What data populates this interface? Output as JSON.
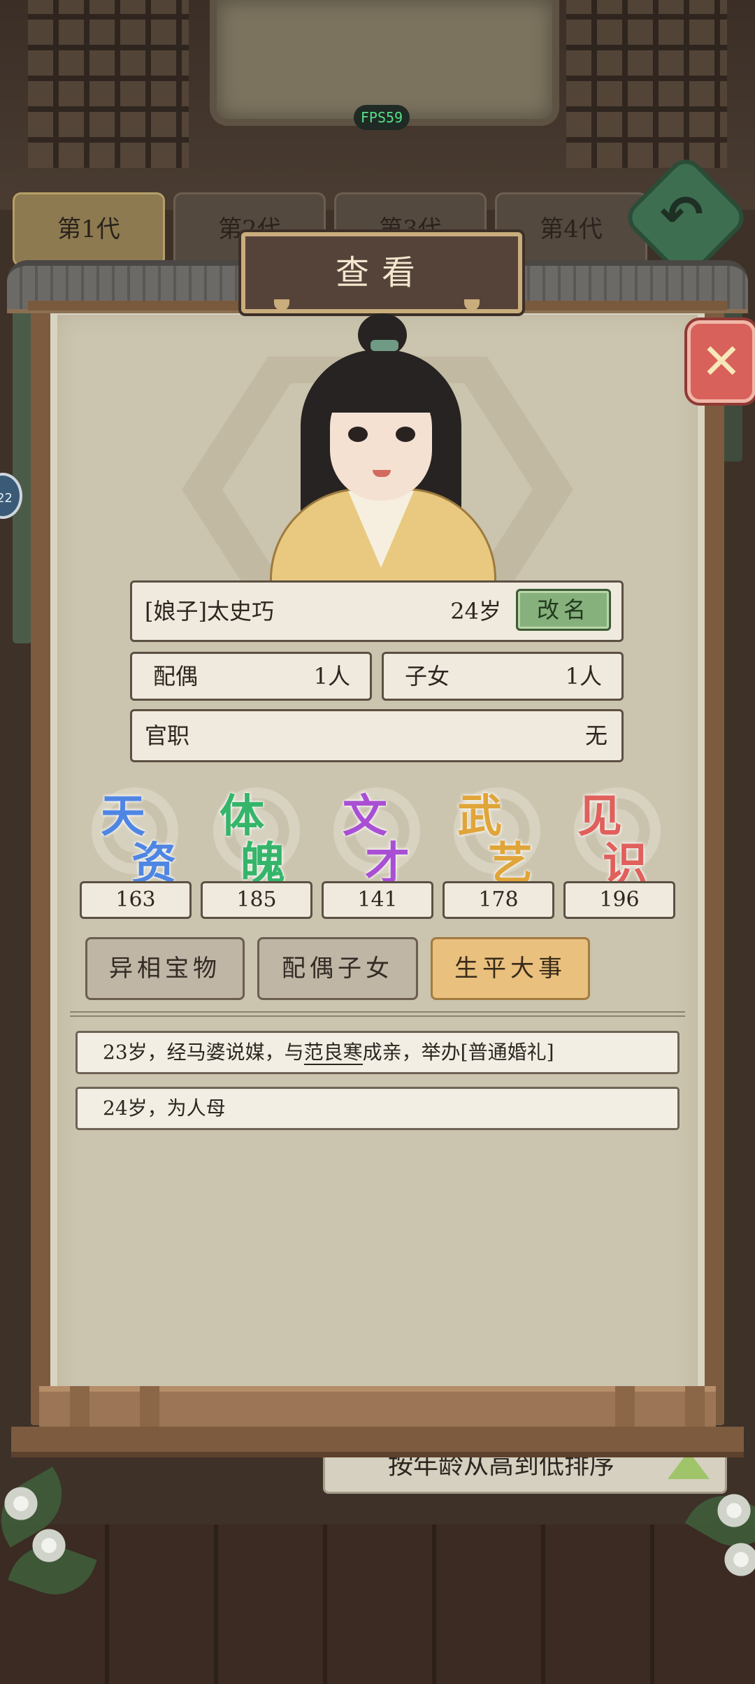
{
  "fps": "FPS59",
  "generation_tabs": [
    "第1代",
    "第2代",
    "第3代",
    "第4代"
  ],
  "side_badge": "22",
  "sort_button": "按年龄从高到低排序",
  "dialog": {
    "title": "查看",
    "close_icon": "close-icon",
    "name": "[娘子]太史巧",
    "age": "24岁",
    "rename_label": "改名",
    "spouse": {
      "label": "配偶",
      "value": "1人"
    },
    "children": {
      "label": "子女",
      "value": "1人"
    },
    "office": {
      "label": "官职",
      "value": "无"
    }
  },
  "stats": [
    {
      "c1": "天",
      "c2": "资",
      "value": "163",
      "color": "#4f86e3"
    },
    {
      "c1": "体",
      "c2": "魄",
      "value": "185",
      "color": "#35b56a"
    },
    {
      "c1": "文",
      "c2": "才",
      "value": "141",
      "color": "#a94fd4"
    },
    {
      "c1": "武",
      "c2": "艺",
      "value": "178",
      "color": "#e0a53a"
    },
    {
      "c1": "见",
      "c2": "识",
      "value": "196",
      "color": "#e0605c"
    }
  ],
  "tabs": [
    "异相宝物",
    "配偶子女",
    "生平大事"
  ],
  "active_tab": 2,
  "events": [
    {
      "prefix": "23岁，经马婆说媒，与",
      "link": "范良寒",
      "suffix": "成亲，举办[普通婚礼]"
    },
    {
      "prefix": "24岁，为人母",
      "link": "",
      "suffix": ""
    }
  ],
  "colors": {
    "active_tab": "#e9c07e",
    "rename": "#86b07c",
    "close": "#d9615b"
  }
}
